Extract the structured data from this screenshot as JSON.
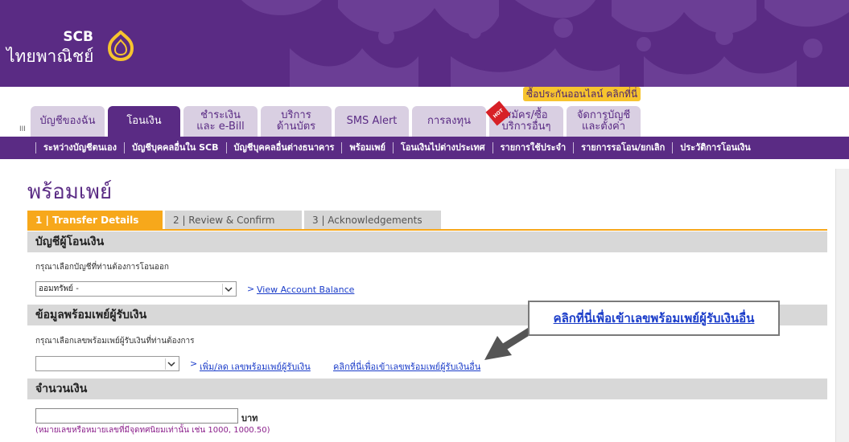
{
  "brand": {
    "short": "SCB",
    "thai": "ไทยพาณิชย์",
    "primary_color": "#5a2b84",
    "accent_color": "#f7a81b"
  },
  "promo": {
    "label": "ซื้อประกันออนไลน์ คลิกที่นี่"
  },
  "hot_badge": "HOT",
  "tabs": [
    {
      "line1": "บัญชีของฉัน",
      "line2": ""
    },
    {
      "line1": "โอนเงิน",
      "line2": ""
    },
    {
      "line1": "ชำระเงิน",
      "line2": "และ e-Bill"
    },
    {
      "line1": "บริการ",
      "line2": "ด้านบัตร"
    },
    {
      "line1": "SMS Alert",
      "line2": ""
    },
    {
      "line1": "การลงทุน",
      "line2": ""
    },
    {
      "line1": "สมัคร/ซื้อ",
      "line2": "บริการอื่นๆ"
    },
    {
      "line1": "จัดการบัญชี",
      "line2": "และตั้งค่า"
    }
  ],
  "active_tab": "โอนเงิน",
  "subnav": [
    "ระหว่างบัญชีตนเอง",
    "บัญชีบุคคลอื่นใน SCB",
    "บัญชีบุคคลอื่นต่างธนาคาร",
    "พร้อมเพย์",
    "โอนเงินไปต่างประเทศ",
    "รายการใช้ประจำ",
    "รายการรอโอน/ยกเลิก",
    "ประวัติการโอนเงิน"
  ],
  "page": {
    "title": "พร้อมเพย์"
  },
  "steps": [
    {
      "label": "1 | Transfer Details",
      "state": "active"
    },
    {
      "label": "2 | Review & Confirm",
      "state": "inactive"
    },
    {
      "label": "3 | Acknowledgements",
      "state": "inactive"
    }
  ],
  "from_account": {
    "heading": "บัญชีผู้โอนเงิน",
    "hint": "กรุณาเลือกบัญชีที่ท่านต้องการโอนออก",
    "selected": "ออมทรัพย์ -",
    "balance_link": "View Account Balance"
  },
  "promptpay": {
    "heading": "ข้อมูลพร้อมเพย์ผู้รับเงิน",
    "hint": "กรุณาเลือกเลขพร้อมเพย์ผู้รับเงินที่ท่านต้องการ",
    "selected": "",
    "manage_link": "เพิ่ม/ลด เลขพร้อมเพย์ผู้รับเงิน",
    "other_link": "คลิกที่นี่เพื่อเข้าเลขพร้อมเพย์ผู้รับเงินอื่น"
  },
  "callout": {
    "text": "คลิกที่นี่เพื่อเข้าเลขพร้อมเพย์ผู้รับเงินอื่น"
  },
  "amount": {
    "heading": "จำนวนเงิน",
    "value": "",
    "unit": "บาท",
    "note": "(หมายเลขหรือหมายเลขที่มีจุดทศนิยมเท่านั้น เช่น 1000, 1000.50)"
  },
  "collapse_marker": "III"
}
